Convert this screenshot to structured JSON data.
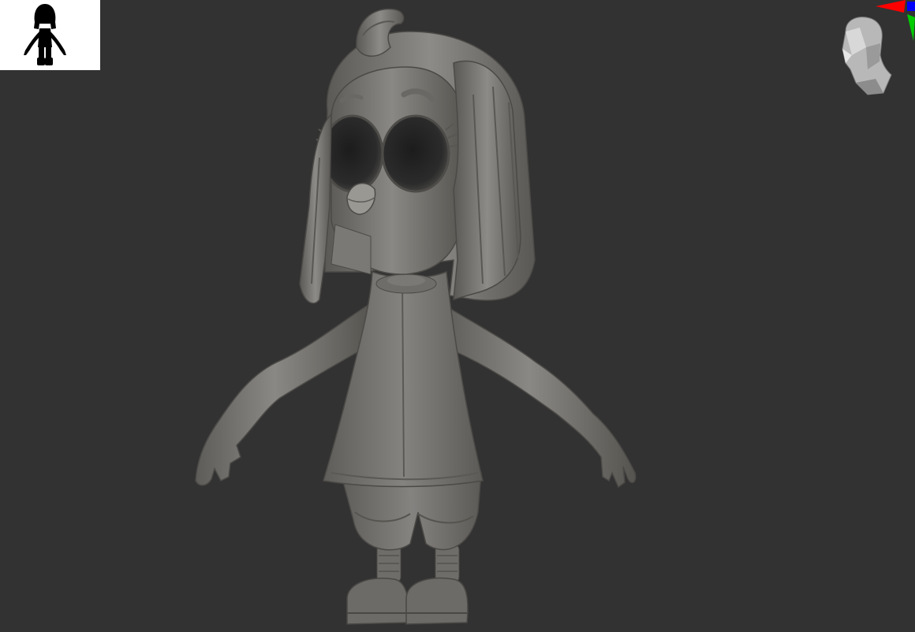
{
  "app": {
    "canvas_background": "#323232"
  },
  "thumbnail": {
    "icon": "character-silhouette-icon",
    "background": "#ffffff",
    "fill": "#000000"
  },
  "model": {
    "icon": "sculpted-character-model",
    "material_color": "#7a7874"
  },
  "navigation": {
    "icon": "navigation-head-icon",
    "axis_colors": {
      "x": "#ff0000",
      "y": "#00cc00",
      "z": "#0000ff"
    }
  }
}
